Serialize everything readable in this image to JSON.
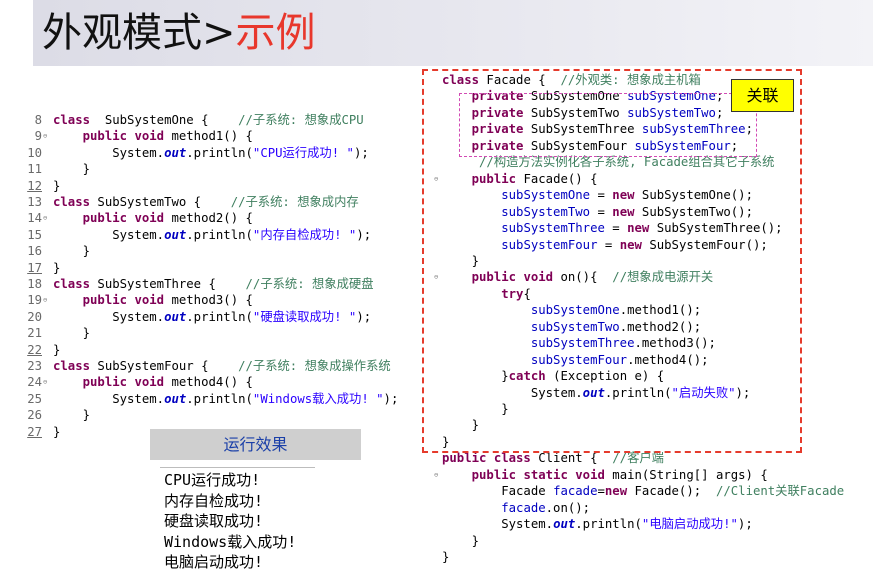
{
  "slide": {
    "title_main": "外观模式>",
    "title_accent": "示例"
  },
  "left_code": [
    {
      "ln": "8",
      "fold": false,
      "u": false,
      "parts": [
        [
          "kw",
          "class"
        ],
        [
          "",
          "  SubSystemOne {    "
        ],
        [
          "cm",
          "//子系统: 想象成CPU"
        ]
      ]
    },
    {
      "ln": "9",
      "fold": true,
      "u": false,
      "parts": [
        [
          "",
          "    "
        ],
        [
          "kw",
          "public void"
        ],
        [
          "",
          " method1() {"
        ]
      ]
    },
    {
      "ln": "10",
      "fold": false,
      "u": false,
      "parts": [
        [
          "",
          "        System."
        ],
        [
          "it",
          "out"
        ],
        [
          "",
          ".println("
        ],
        [
          "st",
          "\"CPU运行成功! \""
        ],
        [
          "",
          ");"
        ]
      ]
    },
    {
      "ln": "11",
      "fold": false,
      "u": false,
      "parts": [
        [
          "",
          "    }"
        ]
      ]
    },
    {
      "ln": "12",
      "fold": false,
      "u": true,
      "parts": [
        [
          "",
          "}"
        ]
      ]
    },
    {
      "ln": "13",
      "fold": false,
      "u": false,
      "parts": [
        [
          "kw",
          "class"
        ],
        [
          "",
          " SubSystemTwo {    "
        ],
        [
          "cm",
          "//子系统: 想象成内存"
        ]
      ]
    },
    {
      "ln": "14",
      "fold": true,
      "u": false,
      "parts": [
        [
          "",
          "    "
        ],
        [
          "kw",
          "public void"
        ],
        [
          "",
          " method2() {"
        ]
      ]
    },
    {
      "ln": "15",
      "fold": false,
      "u": false,
      "parts": [
        [
          "",
          "        System."
        ],
        [
          "it",
          "out"
        ],
        [
          "",
          ".println("
        ],
        [
          "st",
          "\"内存自检成功! \""
        ],
        [
          "",
          ");"
        ]
      ]
    },
    {
      "ln": "16",
      "fold": false,
      "u": false,
      "parts": [
        [
          "",
          "    }"
        ]
      ]
    },
    {
      "ln": "17",
      "fold": false,
      "u": true,
      "parts": [
        [
          "",
          "}"
        ]
      ]
    },
    {
      "ln": "18",
      "fold": false,
      "u": false,
      "parts": [
        [
          "kw",
          "class"
        ],
        [
          "",
          " SubSystemThree {    "
        ],
        [
          "cm",
          "//子系统: 想象成硬盘"
        ]
      ]
    },
    {
      "ln": "19",
      "fold": true,
      "u": false,
      "parts": [
        [
          "",
          "    "
        ],
        [
          "kw",
          "public void"
        ],
        [
          "",
          " method3() {"
        ]
      ]
    },
    {
      "ln": "20",
      "fold": false,
      "u": false,
      "parts": [
        [
          "",
          "        System."
        ],
        [
          "it",
          "out"
        ],
        [
          "",
          ".println("
        ],
        [
          "st",
          "\"硬盘读取成功! \""
        ],
        [
          "",
          ");"
        ]
      ]
    },
    {
      "ln": "21",
      "fold": false,
      "u": false,
      "parts": [
        [
          "",
          "    }"
        ]
      ]
    },
    {
      "ln": "22",
      "fold": false,
      "u": true,
      "parts": [
        [
          "",
          "}"
        ]
      ]
    },
    {
      "ln": "23",
      "fold": false,
      "u": false,
      "parts": [
        [
          "kw",
          "class"
        ],
        [
          "",
          " SubSystemFour {    "
        ],
        [
          "cm",
          "//子系统: 想象成操作系统"
        ]
      ]
    },
    {
      "ln": "24",
      "fold": true,
      "u": false,
      "parts": [
        [
          "",
          "    "
        ],
        [
          "kw",
          "public void"
        ],
        [
          "",
          " method4() {"
        ]
      ]
    },
    {
      "ln": "25",
      "fold": false,
      "u": false,
      "parts": [
        [
          "",
          "        System."
        ],
        [
          "it",
          "out"
        ],
        [
          "",
          ".println("
        ],
        [
          "st",
          "\"Windows载入成功! \""
        ],
        [
          "",
          ");"
        ]
      ]
    },
    {
      "ln": "26",
      "fold": false,
      "u": false,
      "parts": [
        [
          "",
          "    }"
        ]
      ]
    },
    {
      "ln": "27",
      "fold": false,
      "u": true,
      "parts": [
        [
          "",
          "}"
        ]
      ]
    }
  ],
  "right_code": [
    {
      "fold": false,
      "parts": [
        [
          "kw",
          "class"
        ],
        [
          "",
          " Facade {  "
        ],
        [
          "cm",
          "//外观类: 想象成主机箱"
        ]
      ]
    },
    {
      "fold": false,
      "parts": [
        [
          "",
          "    "
        ],
        [
          "kw",
          "private"
        ],
        [
          "",
          " SubSystemOne "
        ],
        [
          "fd",
          "subSystemOne"
        ],
        [
          "",
          ";"
        ]
      ]
    },
    {
      "fold": false,
      "parts": [
        [
          "",
          "    "
        ],
        [
          "kw",
          "private"
        ],
        [
          "",
          " SubSystemTwo "
        ],
        [
          "fd",
          "subSystemTwo"
        ],
        [
          "",
          ";"
        ]
      ]
    },
    {
      "fold": false,
      "parts": [
        [
          "",
          "    "
        ],
        [
          "kw",
          "private"
        ],
        [
          "",
          " SubSystemThree "
        ],
        [
          "fd",
          "subSystemThree"
        ],
        [
          "",
          ";"
        ]
      ]
    },
    {
      "fold": false,
      "parts": [
        [
          "",
          "    "
        ],
        [
          "kw",
          "private"
        ],
        [
          "",
          " SubSystemFour "
        ],
        [
          "fd",
          "subSystemFour"
        ],
        [
          "",
          ";"
        ]
      ]
    },
    {
      "fold": false,
      "parts": [
        [
          "",
          "     "
        ],
        [
          "cm",
          "//构造方法实例化各子系统, Facade组合其它子系统"
        ]
      ]
    },
    {
      "fold": true,
      "parts": [
        [
          "",
          "    "
        ],
        [
          "kw",
          "public"
        ],
        [
          "",
          " Facade() {"
        ]
      ]
    },
    {
      "fold": false,
      "parts": [
        [
          "",
          "        "
        ],
        [
          "fd",
          "subSystemOne"
        ],
        [
          "",
          " = "
        ],
        [
          "kw",
          "new"
        ],
        [
          "",
          " SubSystemOne();"
        ]
      ]
    },
    {
      "fold": false,
      "parts": [
        [
          "",
          "        "
        ],
        [
          "fd",
          "subSystemTwo"
        ],
        [
          "",
          " = "
        ],
        [
          "kw",
          "new"
        ],
        [
          "",
          " SubSystemTwo();"
        ]
      ]
    },
    {
      "fold": false,
      "parts": [
        [
          "",
          "        "
        ],
        [
          "fd",
          "subSystemThree"
        ],
        [
          "",
          " = "
        ],
        [
          "kw",
          "new"
        ],
        [
          "",
          " SubSystemThree();"
        ]
      ]
    },
    {
      "fold": false,
      "parts": [
        [
          "",
          "        "
        ],
        [
          "fd",
          "subSystemFour"
        ],
        [
          "",
          " = "
        ],
        [
          "kw",
          "new"
        ],
        [
          "",
          " SubSystemFour();"
        ]
      ]
    },
    {
      "fold": false,
      "parts": [
        [
          "",
          "    }"
        ]
      ]
    },
    {
      "fold": true,
      "parts": [
        [
          "",
          "    "
        ],
        [
          "kw",
          "public void"
        ],
        [
          "",
          " on(){  "
        ],
        [
          "cm",
          "//想象成电源开关"
        ]
      ]
    },
    {
      "fold": false,
      "parts": [
        [
          "",
          "        "
        ],
        [
          "kw",
          "try"
        ],
        [
          "",
          "{"
        ]
      ]
    },
    {
      "fold": false,
      "parts": [
        [
          "",
          "            "
        ],
        [
          "fd",
          "subSystemOne"
        ],
        [
          "",
          ".method1();"
        ]
      ]
    },
    {
      "fold": false,
      "parts": [
        [
          "",
          "            "
        ],
        [
          "fd",
          "subSystemTwo"
        ],
        [
          "",
          ".method2();"
        ]
      ]
    },
    {
      "fold": false,
      "parts": [
        [
          "",
          "            "
        ],
        [
          "fd",
          "subSystemThree"
        ],
        [
          "",
          ".method3();"
        ]
      ]
    },
    {
      "fold": false,
      "parts": [
        [
          "",
          "            "
        ],
        [
          "fd",
          "subSystemFour"
        ],
        [
          "",
          ".method4();"
        ]
      ]
    },
    {
      "fold": false,
      "parts": [
        [
          "",
          "        }"
        ],
        [
          "kw",
          "catch"
        ],
        [
          "",
          " (Exception e) {"
        ]
      ]
    },
    {
      "fold": false,
      "parts": [
        [
          "",
          "            System."
        ],
        [
          "it",
          "out"
        ],
        [
          "",
          ".println("
        ],
        [
          "st",
          "\"启动失败\""
        ],
        [
          "",
          ");"
        ]
      ]
    },
    {
      "fold": false,
      "parts": [
        [
          "",
          "        }"
        ]
      ]
    },
    {
      "fold": false,
      "parts": [
        [
          "",
          "    }"
        ]
      ]
    },
    {
      "fold": false,
      "parts": [
        [
          "",
          "}"
        ]
      ]
    },
    {
      "fold": false,
      "parts": [
        [
          "kw",
          "public class"
        ],
        [
          "",
          " Client {  "
        ],
        [
          "cm",
          "//客户端"
        ]
      ]
    },
    {
      "fold": true,
      "parts": [
        [
          "",
          "    "
        ],
        [
          "kw",
          "public static void"
        ],
        [
          "",
          " main(String[] args) {"
        ]
      ]
    },
    {
      "fold": false,
      "parts": [
        [
          "",
          "        Facade "
        ],
        [
          "fd",
          "facade"
        ],
        [
          "",
          "="
        ],
        [
          "kw",
          "new"
        ],
        [
          "",
          " Facade();  "
        ],
        [
          "cm",
          "//Client关联Facade"
        ]
      ]
    },
    {
      "fold": false,
      "parts": [
        [
          "",
          "        "
        ],
        [
          "fd",
          "facade"
        ],
        [
          "",
          ".on();"
        ]
      ]
    },
    {
      "fold": false,
      "parts": [
        [
          "",
          "        System."
        ],
        [
          "it",
          "out"
        ],
        [
          "",
          ".println("
        ],
        [
          "st",
          "\"电脑启动成功!\""
        ],
        [
          "",
          ");"
        ]
      ]
    },
    {
      "fold": false,
      "parts": [
        [
          "",
          "    }"
        ]
      ]
    },
    {
      "fold": false,
      "parts": [
        [
          "",
          "}"
        ]
      ]
    }
  ],
  "assoc_label": "关联",
  "result": {
    "title": "运行效果",
    "lines": [
      "CPU运行成功!",
      "内存自检成功!",
      "硬盘读取成功!",
      "Windows载入成功!",
      "电脑启动成功!"
    ]
  }
}
